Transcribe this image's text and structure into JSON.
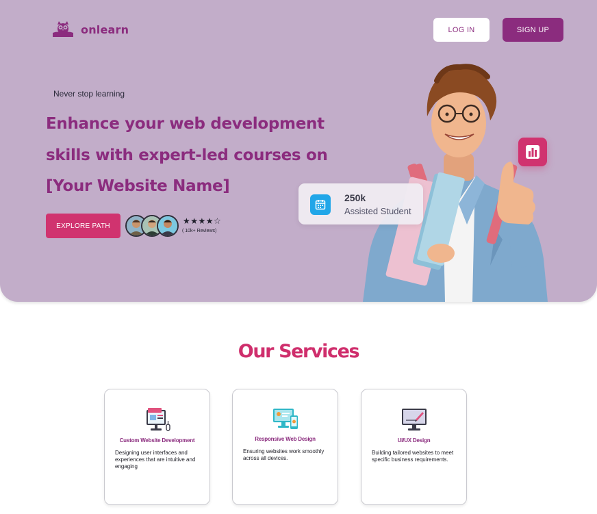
{
  "brand": {
    "name": "onlearn"
  },
  "nav": {
    "login_label": "LOG IN",
    "signup_label": "SIGN UP"
  },
  "hero": {
    "tagline": "Never stop learning",
    "headline": "Enhance your web development skills with expert-led courses on [Your Website Name]",
    "cta_label": "EXPLORE PATH",
    "rating": "★★★★☆",
    "rating_value": 4.5,
    "reviews_label": "( 10k+ Reviews)"
  },
  "stat": {
    "value": "250k",
    "label": "Assisted Student"
  },
  "services": {
    "title": "Our Services",
    "cards": [
      {
        "title": "Custom Website Development",
        "desc": "Designing user interfaces and experiences that are intuitive and engaging",
        "icon": "desktop-code-icon"
      },
      {
        "title": "Responsive Web Design",
        "desc": "Ensuring websites work smoothly across all devices.",
        "icon": "responsive-devices-icon"
      },
      {
        "title": "UI/UX Design",
        "desc": "Building tailored websites to meet specific business requirements.",
        "icon": "monitor-pen-icon"
      }
    ]
  },
  "colors": {
    "hero_bg": "#c2adc9",
    "brand_purple": "#8b2c7e",
    "accent_pink": "#d0336f",
    "stat_icon_blue": "#21a6e8"
  }
}
